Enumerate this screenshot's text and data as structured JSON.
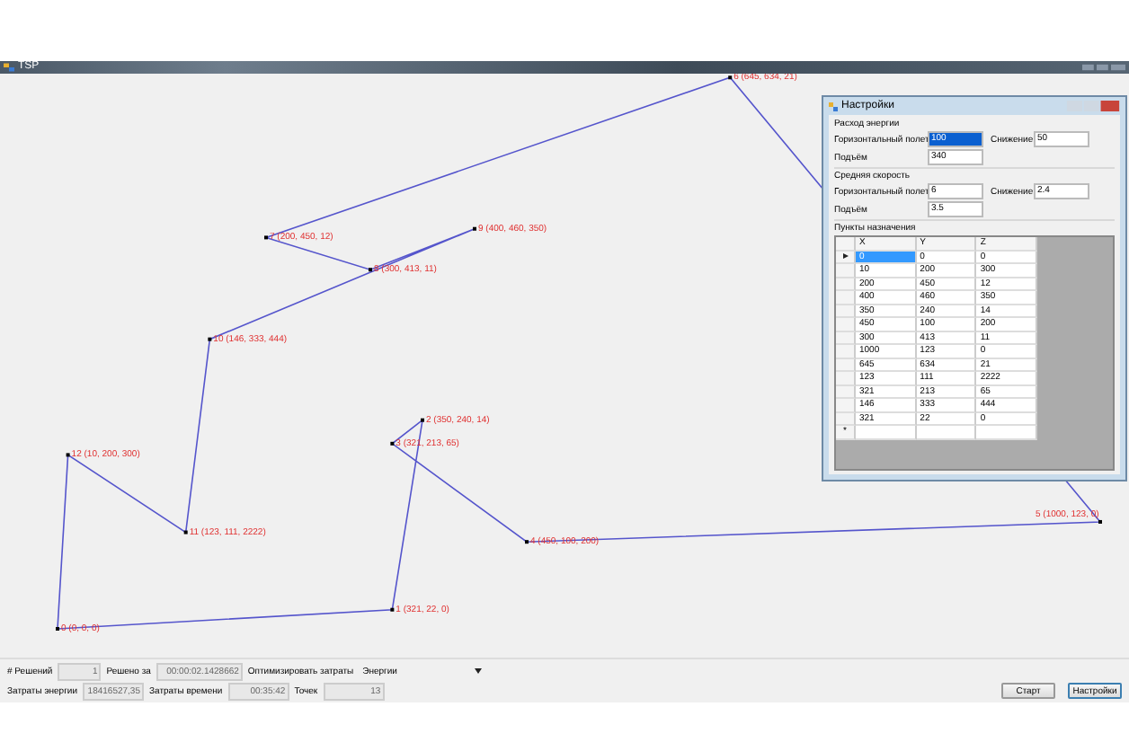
{
  "window": {
    "title": "TSP"
  },
  "points": [
    {
      "label": "0 (0, 0, 0)"
    },
    {
      "label": "1 (321, 22, 0)"
    },
    {
      "label": "2 (350, 240, 14)"
    },
    {
      "label": "3 (321, 213, 65)"
    },
    {
      "label": "4 (450, 100, 200)"
    },
    {
      "label": "5 (1000, 123, 0)"
    },
    {
      "label": "6 (645, 634, 21)"
    },
    {
      "label": "7 (200, 450, 12)"
    },
    {
      "label": "8 (300, 413, 11)"
    },
    {
      "label": "9 (400, 460, 350)"
    },
    {
      "label": "10 (146, 333, 444)"
    },
    {
      "label": "11 (123, 111, 2222)"
    },
    {
      "label": "12 (10, 200, 300)"
    }
  ],
  "settings": {
    "title": "Настройки",
    "groups": [
      {
        "title": "Расход энергии",
        "fields": [
          {
            "label": "Горизонтальный полет",
            "value": "100",
            "selected": true
          },
          {
            "label": "Снижение",
            "value": "50",
            "selected": false
          },
          {
            "label": "Подъём",
            "value": "340",
            "selected": false
          }
        ]
      },
      {
        "title": "Средняя скорость",
        "fields": [
          {
            "label": "Горизонтальный полет",
            "value": "6",
            "selected": false
          },
          {
            "label": "Снижение",
            "value": "2.4",
            "selected": false
          },
          {
            "label": "Подъём",
            "value": "3.5",
            "selected": false
          }
        ]
      }
    ],
    "table_title": "Пункты назначения",
    "columns": [
      "X",
      "Y",
      "Z"
    ],
    "rows": [
      [
        "0",
        "0",
        "0"
      ],
      [
        "10",
        "200",
        "300"
      ],
      [
        "200",
        "450",
        "12"
      ],
      [
        "400",
        "460",
        "350"
      ],
      [
        "350",
        "240",
        "14"
      ],
      [
        "450",
        "100",
        "200"
      ],
      [
        "300",
        "413",
        "11"
      ],
      [
        "1000",
        "123",
        "0"
      ],
      [
        "645",
        "634",
        "21"
      ],
      [
        "123",
        "111",
        "2222"
      ],
      [
        "321",
        "213",
        "65"
      ],
      [
        "146",
        "333",
        "444"
      ],
      [
        "321",
        "22",
        "0"
      ]
    ],
    "new_row_mark": "*"
  },
  "status": {
    "solutions_label": "# Решений",
    "solutions": "1",
    "solved_in_label": "Решено за",
    "solved_in": "00:00:02.1428662",
    "optimize_label": "Оптимизировать затраты",
    "optimize": "Энергии",
    "energy_label": "Затраты энергии",
    "energy": "18416527,35",
    "time_label": "Затраты времени",
    "time": "00:35:42",
    "points_label": "Точек",
    "points": "13"
  },
  "buttons": [
    "Старт",
    "Настройки"
  ]
}
